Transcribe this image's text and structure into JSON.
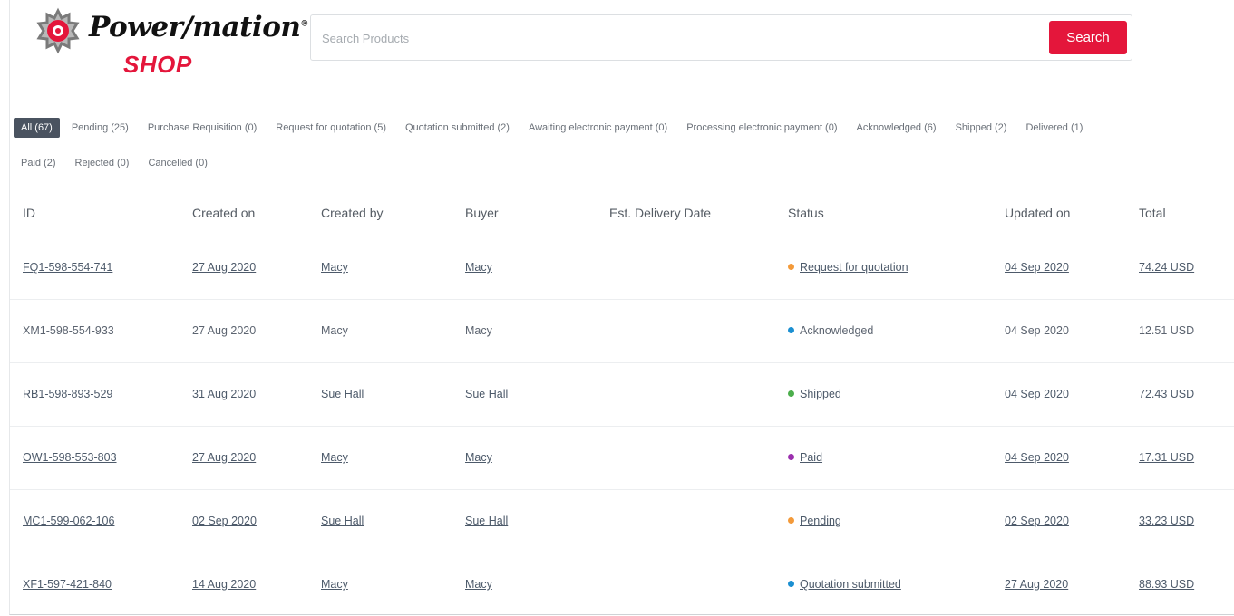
{
  "brand": {
    "wordmark": "Power/mation",
    "registered": "®",
    "sub": "SHOP"
  },
  "search": {
    "placeholder": "Search Products",
    "button_label": "Search",
    "accent_color": "#e4163b"
  },
  "filters": {
    "row1": [
      {
        "label": "All (67)",
        "active": true
      },
      {
        "label": "Pending (25)"
      },
      {
        "label": "Purchase Requisition (0)"
      },
      {
        "label": "Request for quotation (5)"
      },
      {
        "label": "Quotation submitted (2)"
      },
      {
        "label": "Awaiting electronic payment (0)"
      },
      {
        "label": "Processing electronic payment (0)"
      },
      {
        "label": "Acknowledged (6)"
      },
      {
        "label": "Shipped (2)"
      },
      {
        "label": "Delivered (1)"
      }
    ],
    "row2": [
      {
        "label": "Paid (2)"
      },
      {
        "label": "Rejected (0)"
      },
      {
        "label": "Cancelled (0)"
      }
    ]
  },
  "table": {
    "columns": [
      "ID",
      "Created on",
      "Created by",
      "Buyer",
      "Est. Delivery Date",
      "Status",
      "Updated on",
      "Total"
    ],
    "rows": [
      {
        "id": "FQ1-598-554-741",
        "created_on": "27 Aug 2020",
        "created_by": "Macy",
        "buyer": "Macy",
        "est_delivery": "",
        "status": "Request for quotation",
        "status_color": "#f39a3a",
        "updated_on": "04 Sep 2020",
        "total": "74.24 USD",
        "linked": true
      },
      {
        "id": "XM1-598-554-933",
        "created_on": "27 Aug 2020",
        "created_by": "Macy",
        "buyer": "Macy",
        "est_delivery": "",
        "status": "Acknowledged",
        "status_color": "#1b8fd1",
        "updated_on": "04 Sep 2020",
        "total": "12.51 USD",
        "linked": false
      },
      {
        "id": "RB1-598-893-529",
        "created_on": "31 Aug 2020",
        "created_by": "Sue Hall",
        "buyer": "Sue Hall",
        "est_delivery": "",
        "status": "Shipped",
        "status_color": "#4cae4c",
        "updated_on": "04 Sep 2020",
        "total": "72.43 USD",
        "linked": true
      },
      {
        "id": "OW1-598-553-803",
        "created_on": "27 Aug 2020",
        "created_by": "Macy",
        "buyer": "Macy",
        "est_delivery": "",
        "status": "Paid",
        "status_color": "#9b2fae",
        "updated_on": "04 Sep 2020",
        "total": "17.31 USD",
        "linked": true
      },
      {
        "id": "MC1-599-062-106",
        "created_on": "02 Sep 2020",
        "created_by": "Sue Hall",
        "buyer": "Sue Hall",
        "est_delivery": "",
        "status": "Pending",
        "status_color": "#f39a3a",
        "updated_on": "02 Sep 2020",
        "total": "33.23 USD",
        "linked": true
      },
      {
        "id": "XF1-597-421-840",
        "created_on": "14 Aug 2020",
        "created_by": "Macy",
        "buyer": "Macy",
        "est_delivery": "",
        "status": "Quotation submitted",
        "status_color": "#1b8fd1",
        "updated_on": "27 Aug 2020",
        "total": "88.93 USD",
        "linked": true
      }
    ]
  }
}
